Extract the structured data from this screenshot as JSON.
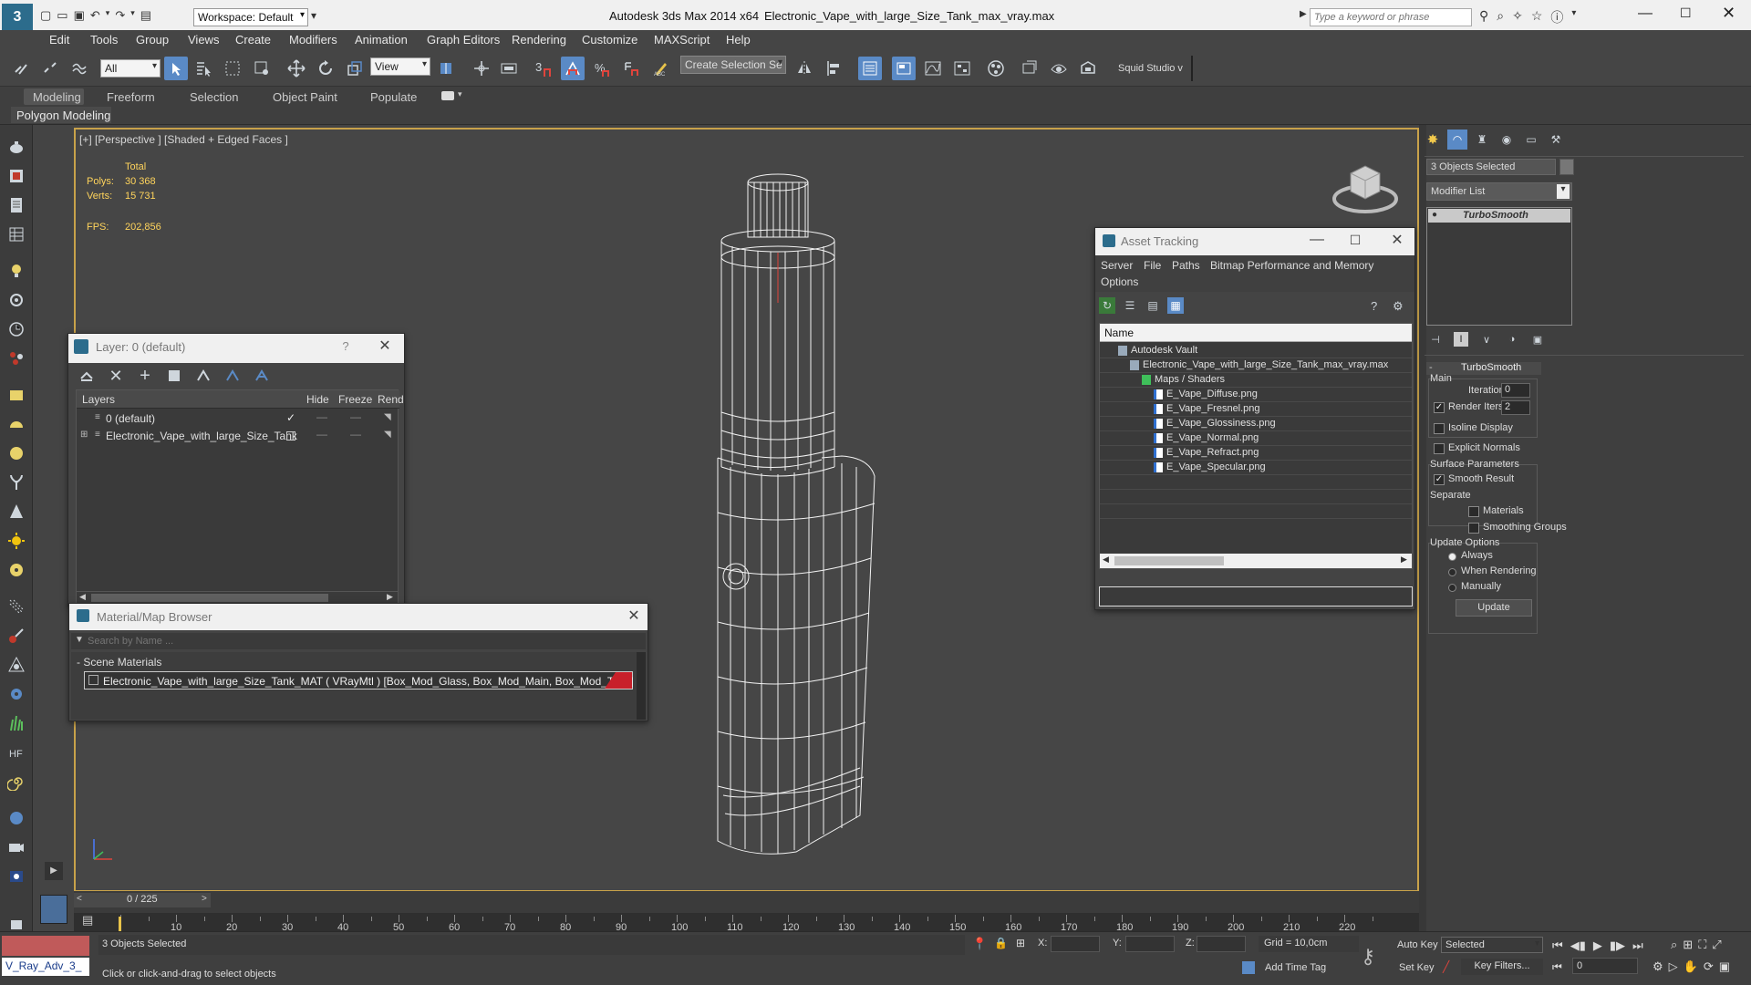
{
  "titlebar": {
    "workspace": "Workspace: Default",
    "app_title": "Autodesk 3ds Max  2014 x64",
    "file_title": "Electronic_Vape_with_large_Size_Tank_max_vray.max",
    "search_placeholder": "Type a keyword or phrase"
  },
  "menu": [
    "Edit",
    "Tools",
    "Group",
    "Views",
    "Create",
    "Modifiers",
    "Animation",
    "Graph Editors",
    "Rendering",
    "Customize",
    "MAXScript",
    "Help"
  ],
  "toolbar": {
    "filter": "All",
    "refcoord": "View",
    "selection_set": "Create Selection Se",
    "squid": "Squid Studio v"
  },
  "ribbon": {
    "tabs": [
      "Modeling",
      "Freeform",
      "Selection",
      "Object Paint",
      "Populate"
    ],
    "sub": "Polygon Modeling"
  },
  "viewport": {
    "label": "[+] [Perspective ] [Shaded + Edged Faces ]",
    "stats_header": "Total",
    "polys_label": "Polys:",
    "polys": "30 368",
    "verts_label": "Verts:",
    "verts": "15 731",
    "fps_label": "FPS:",
    "fps": "202,856"
  },
  "layer_window": {
    "title": "Layer: 0 (default)",
    "help": "?",
    "cols": [
      "Layers",
      "Hide",
      "Freeze",
      "Rend"
    ],
    "rows": [
      "0 (default)",
      "Electronic_Vape_with_large_Size_Tank"
    ]
  },
  "material_browser": {
    "title": "Material/Map Browser",
    "search_placeholder": "Search by Name ...",
    "section": "- Scene Materials",
    "material": "Electronic_Vape_with_large_Size_Tank_MAT  ( VRayMtl )  [Box_Mod_Glass, Box_Mod_Main, Box_Mod_Tank]"
  },
  "asset_tracking": {
    "title": "Asset Tracking",
    "menu": [
      "Server",
      "File",
      "Paths",
      "Bitmap Performance and Memory",
      "Options"
    ],
    "col": "Name",
    "items": [
      {
        "label": "Autodesk Vault",
        "indent": 0
      },
      {
        "label": "Electronic_Vape_with_large_Size_Tank_max_vray.max",
        "indent": 1
      },
      {
        "label": "Maps / Shaders",
        "indent": 2
      },
      {
        "label": "E_Vape_Diffuse.png",
        "indent": 3
      },
      {
        "label": "E_Vape_Fresnel.png",
        "indent": 3
      },
      {
        "label": "E_Vape_Glossiness.png",
        "indent": 3
      },
      {
        "label": "E_Vape_Normal.png",
        "indent": 3
      },
      {
        "label": "E_Vape_Refract.png",
        "indent": 3
      },
      {
        "label": "E_Vape_Specular.png",
        "indent": 3
      }
    ]
  },
  "command_panel": {
    "selection": "3 Objects Selected",
    "modifier_list": "Modifier List",
    "stack_item": "TurboSmooth",
    "rollout": "TurboSmooth",
    "main": "Main",
    "iterations_label": "Iterations:",
    "iterations": "0",
    "render_iters_label": "Render Iters:",
    "render_iters": "2",
    "isoline": "Isoline Display",
    "explicit": "Explicit Normals",
    "surface": "Surface Parameters",
    "smooth_result": "Smooth Result",
    "separate": "Separate",
    "materials": "Materials",
    "smoothing_groups": "Smoothing Groups",
    "update_options": "Update Options",
    "always": "Always",
    "when_rendering": "When Rendering",
    "manually": "Manually",
    "update_btn": "Update"
  },
  "timeline": {
    "frame": "0 / 225",
    "ticks": [
      "0",
      "10",
      "20",
      "30",
      "40",
      "50",
      "60",
      "70",
      "80",
      "90",
      "100",
      "110",
      "120",
      "130",
      "140",
      "150",
      "160",
      "170",
      "180",
      "190",
      "200",
      "210",
      "220"
    ]
  },
  "status": {
    "script": "V_Ray_Adv_3_",
    "selected": "3 Objects Selected",
    "prompt": "Click or click-and-drag to select objects",
    "x_label": "X:",
    "y_label": "Y:",
    "z_label": "Z:",
    "grid": "Grid = 10,0cm",
    "add_time_tag": "Add Time Tag",
    "auto_key": "Auto Key",
    "set_key": "Set Key",
    "selected_dd": "Selected",
    "key_filters": "Key Filters...",
    "frame_val": "0"
  },
  "colors": {
    "accent": "#5a8ac6",
    "viewport_border": "#c8a24a",
    "stats": "#ffd45c",
    "material_swatch": "#c8202a"
  }
}
